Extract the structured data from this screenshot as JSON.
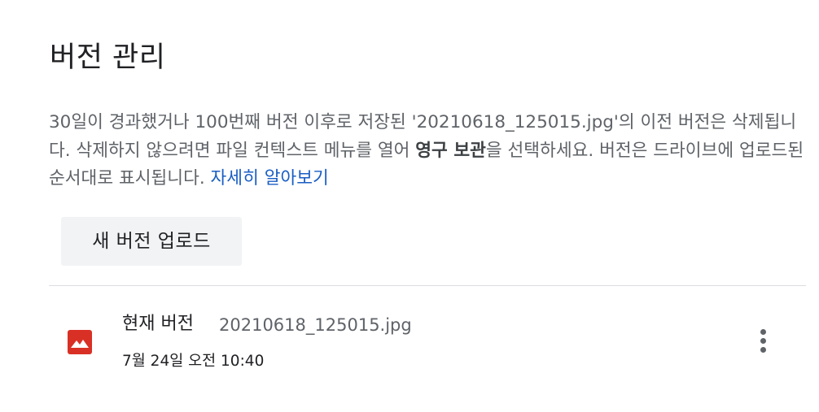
{
  "dialog": {
    "title": "버전 관리",
    "description": {
      "part1": "30일이 경과했거나 100번째 버전 이후로 저장된 '20210618_125015.jpg'의 이전 버전은 삭제됩니다. 삭제하지 않으려면 파일 컨텍스트 메뉴를 열어 ",
      "bold": "영구 보관",
      "part2": "을 선택하세요. 버전은 드라이브에 업로드된 순서대로 표시됩니다. ",
      "link": "자세히 알아보기"
    },
    "upload_button_label": "새 버전 업로드"
  },
  "versions": [
    {
      "label": "현재 버전",
      "filename": "20210618_125015.jpg",
      "date": "7월 24일 오전 10:40",
      "icon": "image-file-icon"
    }
  ],
  "colors": {
    "link": "#1a5ec3",
    "file_icon": "#d93025",
    "button_bg": "#f1f3f4"
  }
}
